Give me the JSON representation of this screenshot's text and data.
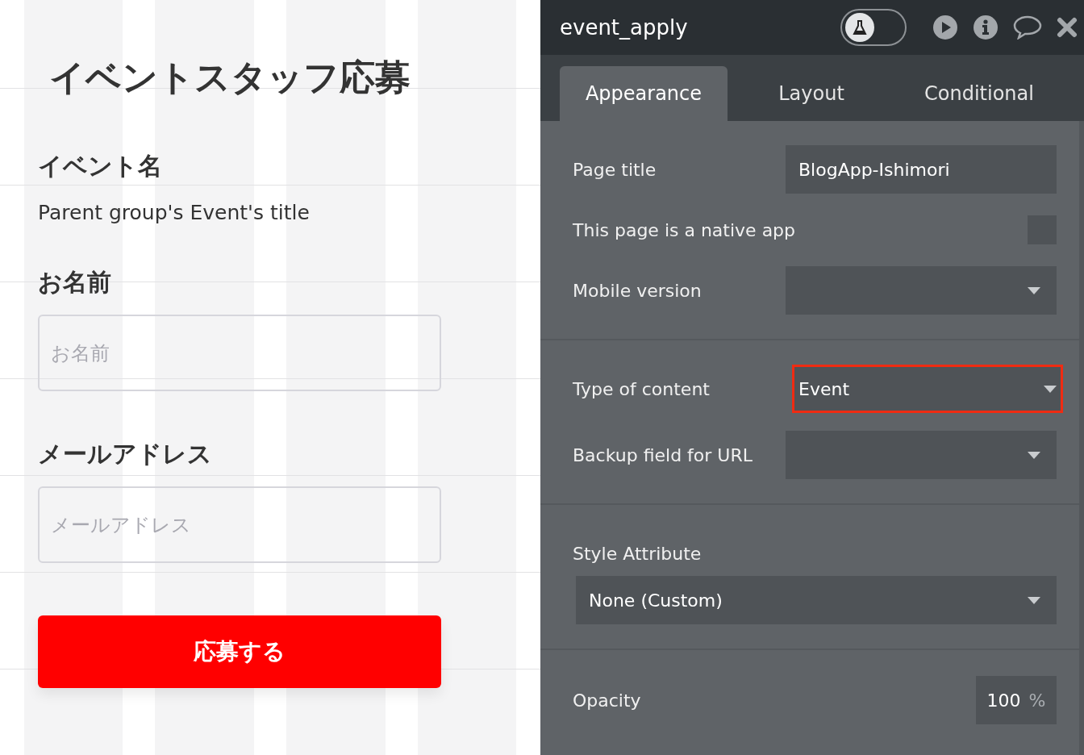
{
  "canvas": {
    "title": "イベントスタッフ応募",
    "fields": [
      {
        "kind": "text",
        "label": "イベント名",
        "value": "Parent group's Event's title"
      },
      {
        "kind": "input",
        "label": "お名前",
        "placeholder": "お名前"
      },
      {
        "kind": "input",
        "label": "メールアドレス",
        "placeholder": "メールアドレス"
      }
    ],
    "submit_button": "応募する"
  },
  "panel": {
    "title": "event_apply",
    "test_mode": {
      "on": false
    },
    "tabs": [
      {
        "label": "Appearance",
        "selected": true
      },
      {
        "label": "Layout",
        "selected": false
      },
      {
        "label": "Conditional",
        "selected": false
      }
    ],
    "sections": [
      [
        {
          "kind": "text",
          "label": "Page title",
          "value": "BlogApp-Ishimori"
        },
        {
          "kind": "checkbox",
          "label": "This page is a native app",
          "checked": false
        },
        {
          "kind": "dropdown",
          "label": "Mobile version",
          "highlighted": false
        }
      ],
      [
        {
          "kind": "dropdown",
          "label": "Type of content",
          "value": "Event",
          "highlighted": true
        },
        {
          "kind": "dropdown",
          "label": "Backup field for URL",
          "highlighted": false
        }
      ],
      [
        {
          "kind": "dropdown_wide",
          "label": "Style Attribute",
          "value": "None (Custom)",
          "highlighted": false
        }
      ],
      [
        {
          "kind": "number",
          "label": "Opacity",
          "value": "100",
          "unit": "%"
        }
      ]
    ]
  }
}
